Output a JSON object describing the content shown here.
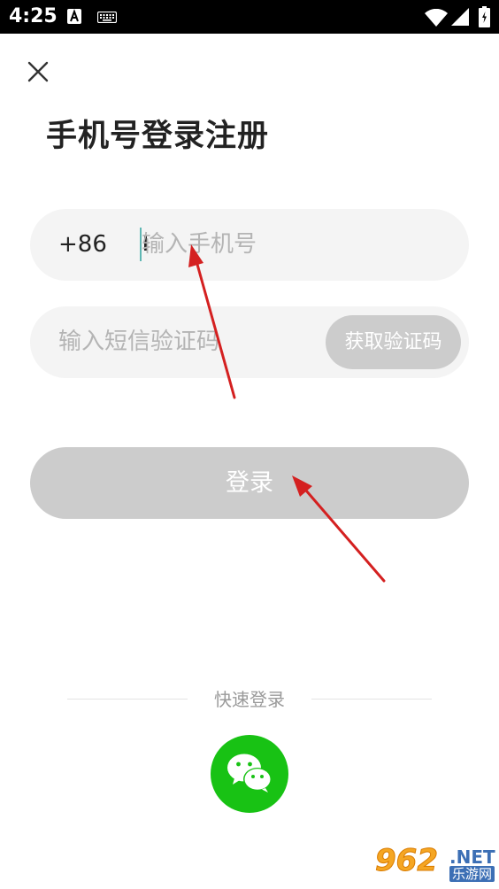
{
  "status_bar": {
    "time": "4:25",
    "icons": [
      "accessibility-a-icon",
      "keyboard-icon",
      "wifi-icon",
      "signal-icon",
      "battery-icon"
    ]
  },
  "header": {
    "close_icon": "close-icon",
    "title": "手机号登录注册"
  },
  "form": {
    "country_code": "+86",
    "phone_placeholder": "输入手机号",
    "phone_value": "",
    "sms_placeholder": "输入短信验证码",
    "sms_value": "",
    "get_code_label": "获取验证码",
    "login_label": "登录"
  },
  "quick_login": {
    "label": "快速登录",
    "wechat_icon": "wechat-icon"
  },
  "watermark": {
    "main": "962",
    "net": ".NET",
    "sub": "乐游网"
  },
  "colors": {
    "background": "#ffffff",
    "field_background": "#f4f4f4",
    "disabled_button": "#cccccc",
    "wechat_green": "#18c214",
    "caret": "#5fb7b3",
    "annotation_arrow": "#d42020"
  }
}
